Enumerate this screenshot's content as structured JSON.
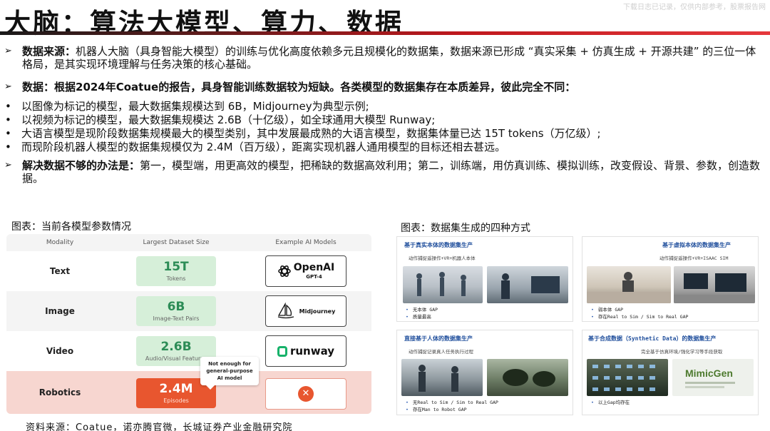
{
  "title": "大脑：算法大模型、算力、数据",
  "watermark": "下载日志已记录，仅供内部参考，股票报告网",
  "paragraphs": {
    "p1": {
      "marker": "➢",
      "lead": "数据来源：",
      "text": "机器人大脑（具身智能大模型）的训练与优化高度依赖多元且规模化的数据集，数据来源已形成 “真实采集 + 仿真生成 + 开源共建” 的三位一体格局，是其实现环境理解与任务决策的核心基础。"
    },
    "p2": {
      "marker": "➢",
      "text": "数据：根据2024年Coatue的报告，具身智能训练数据较为短缺。各类模型的数据集存在本质差异，彼此完全不同："
    },
    "bullets": [
      {
        "marker": "•",
        "text": "以图像为标记的模型，最大数据集规模达到 6B，Midjourney为典型示例;"
      },
      {
        "marker": "•",
        "text": "以视频为标记的模型，最大数据集规模达 2.6B（十亿级），如全球通用大模型 Runway;"
      },
      {
        "marker": "•",
        "text": "大语言模型是现阶段数据集规模最大的模型类别，其中发展最成熟的大语言模型，数据集体量已达 15T tokens（万亿级）;"
      },
      {
        "marker": "•",
        "text": "而现阶段机器人模型的数据集规模仅为 2.4M（百万级），距离实现机器人通用模型的目标还相去甚远。"
      }
    ],
    "p3": {
      "marker": "➢",
      "lead": "解决数据不够的办法是：",
      "text": "第一，模型端，用更高效的模型，把稀缺的数据高效利用；第二，训练端，用仿真训练、模拟训练，改变假设、背景、参数，创造数据。"
    }
  },
  "left_figure": {
    "caption": "图表：当前各模型参数情况",
    "headers": [
      "Modality",
      "Largest Dataset Size",
      "Example AI Models"
    ],
    "rows": [
      {
        "modality": "Text",
        "value": "15T",
        "unit": "Tokens",
        "model": "OpenAI",
        "model_sub": "GPT-4"
      },
      {
        "modality": "Image",
        "value": "6B",
        "unit": "Image-Text Pairs",
        "model": "Midjourney"
      },
      {
        "modality": "Video",
        "value": "2.6B",
        "unit": "Audio/Visual Features",
        "model": "runway"
      },
      {
        "modality": "Robotics",
        "value": "2.4M",
        "unit": "Episodes",
        "model": "✕"
      }
    ],
    "callout": [
      "Not enough for",
      "general-purpose",
      "AI model"
    ],
    "colors": {
      "green_box": "#d6efd9",
      "green_text": "#2c8c56",
      "robotics_row": "#f7d6d0",
      "robotics_box": "#e8562f"
    }
  },
  "right_figure": {
    "caption": "图表：数据集生成的四种方式",
    "panels": [
      {
        "title": "基于真实本体的数据集生产",
        "sub": "动作捕捉遥操作+VR+机器人本体",
        "notes": [
          "无本体 GAP",
          "质量最高"
        ]
      },
      {
        "title": "基于虚拟本体的数据集生产",
        "sub": "动作捕捉遥操作+VR+ISAAC SIM",
        "notes": [
          "弱本体 GAP",
          "存在Real to Sim / Sim to Real GAP"
        ]
      },
      {
        "title": "直接基于人体的数据集生产",
        "sub": "动作捕捉记录真人任务执行过程",
        "notes": [
          "无Real to Sim / Sim to Real GAP",
          "存在Man to Robot GAP"
        ]
      },
      {
        "title": "基于合成数据（Synthetic Data）的数据集生产",
        "sub": "完全基于仿真环境/强化学习等手段获取",
        "notes": [
          "以上Gap均存在"
        ],
        "logo": "MimicGen"
      }
    ]
  },
  "source": "资料来源：Coatue，诺亦腾官微，长城证券产业金融研究院"
}
